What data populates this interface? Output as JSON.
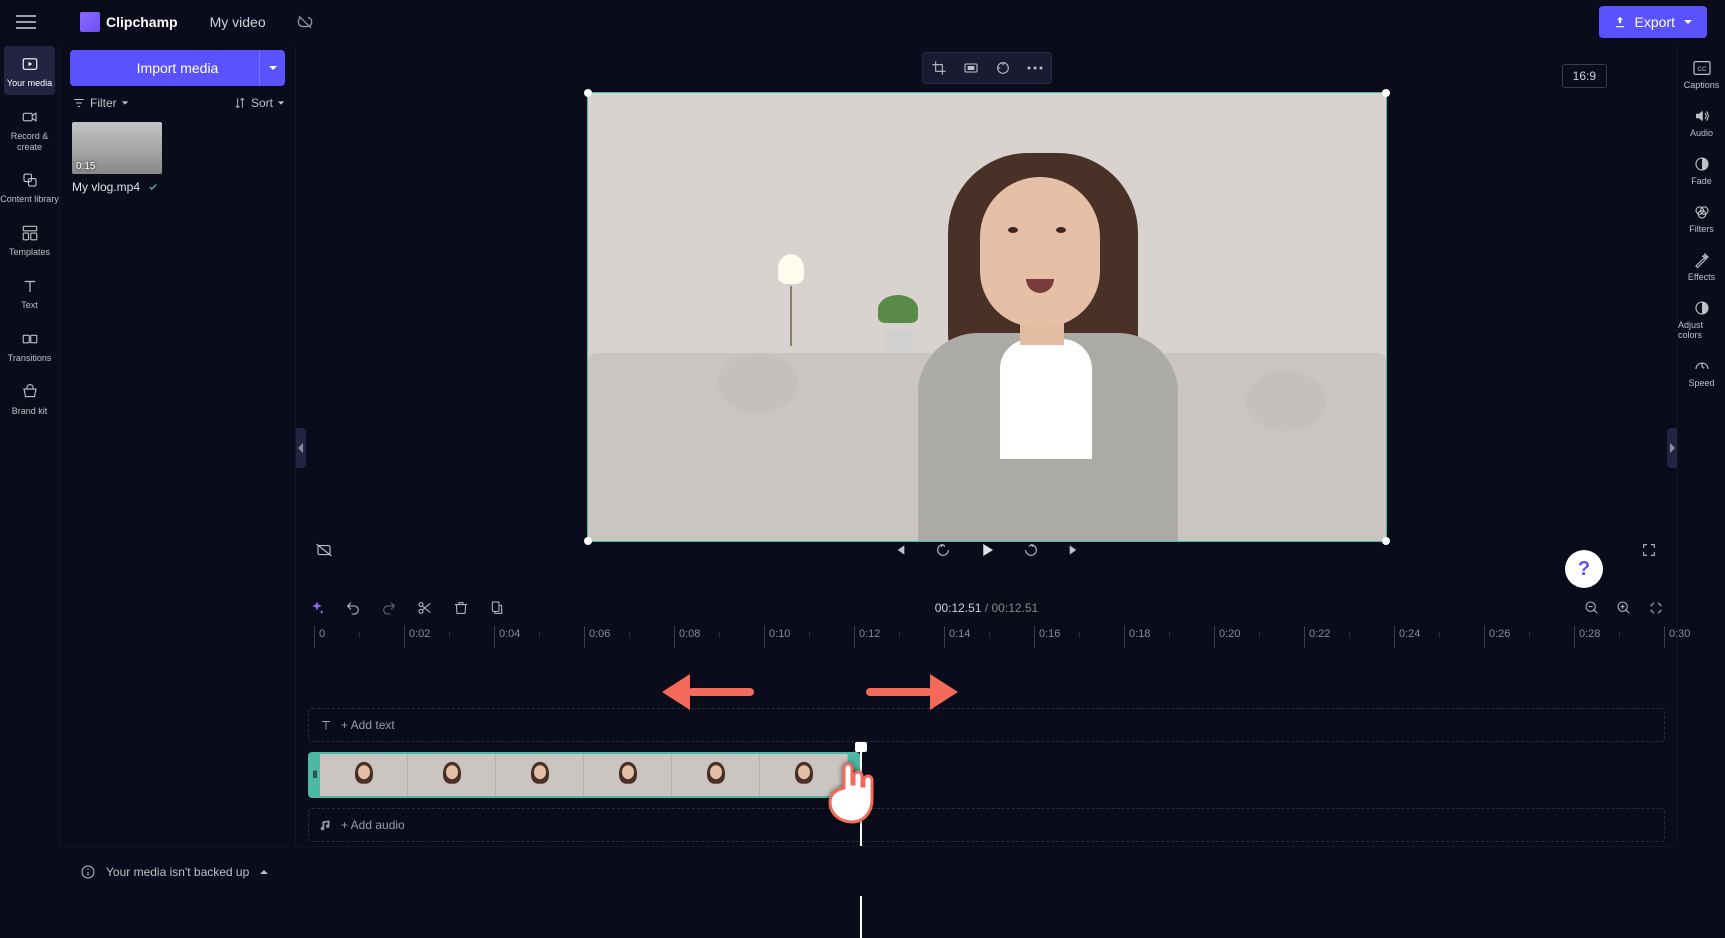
{
  "app": {
    "name": "Clipchamp"
  },
  "project": {
    "name": "My video"
  },
  "export_label": "Export",
  "left_rail": [
    {
      "id": "your-media",
      "label": "Your media"
    },
    {
      "id": "record-create",
      "label": "Record & create"
    },
    {
      "id": "content-library",
      "label": "Content library"
    },
    {
      "id": "templates",
      "label": "Templates"
    },
    {
      "id": "text",
      "label": "Text"
    },
    {
      "id": "transitions",
      "label": "Transitions"
    },
    {
      "id": "brand-kit",
      "label": "Brand kit"
    }
  ],
  "media_panel": {
    "import_label": "Import media",
    "filter_label": "Filter",
    "sort_label": "Sort",
    "asset": {
      "duration": "0:15",
      "filename": "My vlog.mp4"
    }
  },
  "right_rail": [
    {
      "id": "captions",
      "label": "Captions"
    },
    {
      "id": "audio",
      "label": "Audio"
    },
    {
      "id": "fade",
      "label": "Fade"
    },
    {
      "id": "filters",
      "label": "Filters"
    },
    {
      "id": "effects",
      "label": "Effects"
    },
    {
      "id": "adjust-colors",
      "label": "Adjust colors"
    },
    {
      "id": "speed",
      "label": "Speed"
    }
  ],
  "preview": {
    "aspect": "16:9"
  },
  "timeline": {
    "current": "00:12.51",
    "total": "00:12.51",
    "ticks": [
      {
        "t": "0",
        "pos": 18
      },
      {
        "t": "0:02",
        "pos": 108
      },
      {
        "t": "0:04",
        "pos": 198
      },
      {
        "t": "0:06",
        "pos": 288
      },
      {
        "t": "0:08",
        "pos": 378
      },
      {
        "t": "0:10",
        "pos": 468
      },
      {
        "t": "0:12",
        "pos": 558
      },
      {
        "t": "0:14",
        "pos": 648
      },
      {
        "t": "0:16",
        "pos": 738
      },
      {
        "t": "0:18",
        "pos": 828
      },
      {
        "t": "0:20",
        "pos": 918
      },
      {
        "t": "0:22",
        "pos": 1008
      },
      {
        "t": "0:24",
        "pos": 1098
      },
      {
        "t": "0:26",
        "pos": 1188
      },
      {
        "t": "0:28",
        "pos": 1278
      },
      {
        "t": "0:30",
        "pos": 1368
      }
    ],
    "add_text_label": "+  Add text",
    "add_audio_label": "+  Add audio"
  },
  "banner": {
    "text": "Your media isn't backed up"
  },
  "help_glyph": "?"
}
